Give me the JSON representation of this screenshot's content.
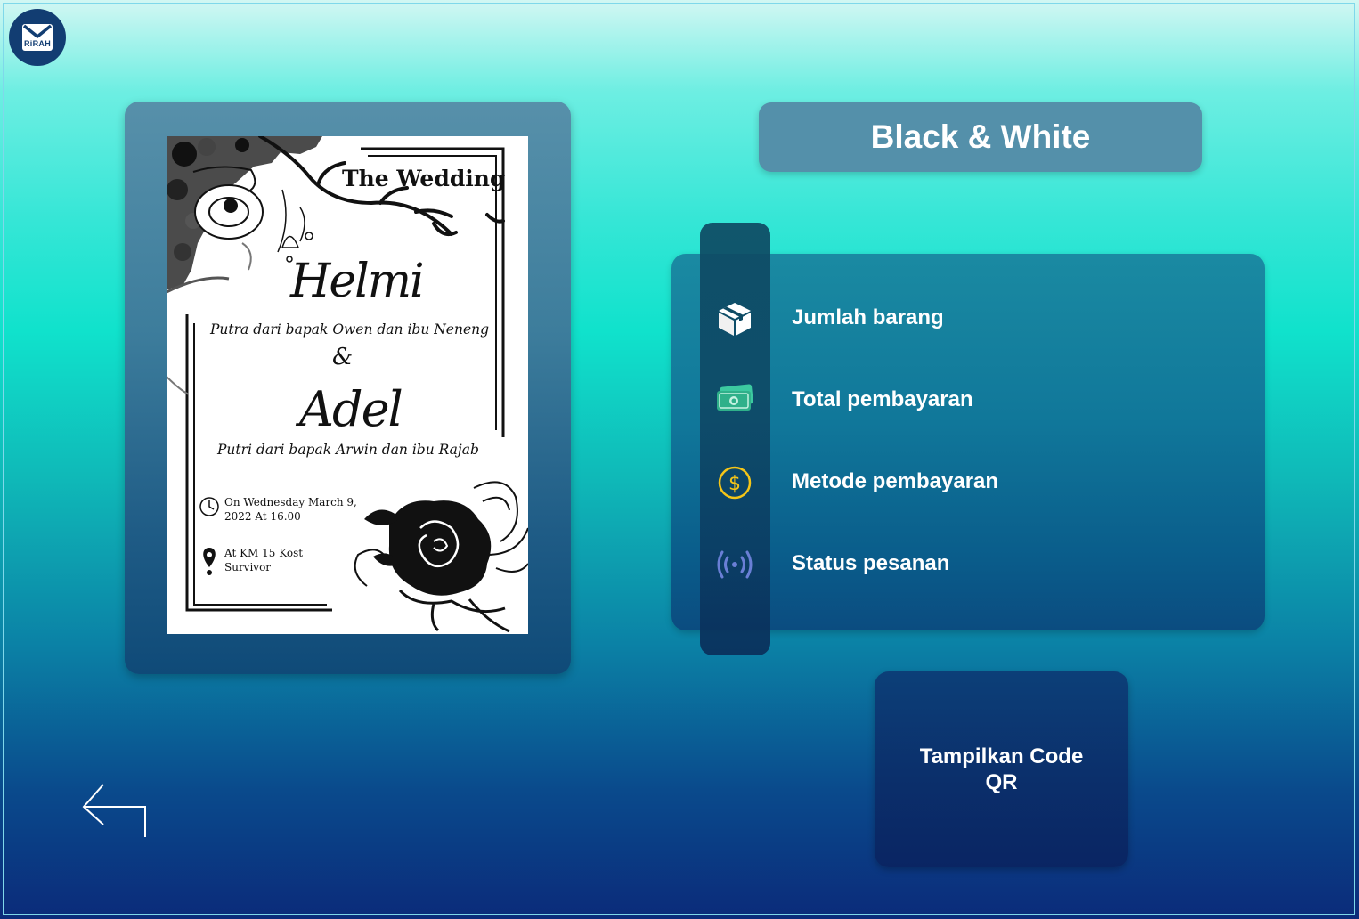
{
  "app": {
    "logo_text": "RiRAH"
  },
  "invitation": {
    "title": "The Wedding",
    "groom_name": "Helmi",
    "groom_parents": "Putra dari bapak Owen dan ibu Neneng",
    "ampersand": "&",
    "bride_name": "Adel",
    "bride_parents": "Putri dari bapak Arwin dan ibu Rajab",
    "date_text": "On Wednesday March 9, 2022 At 16.00",
    "place_text": "At KM 15 Kost Survivor"
  },
  "product": {
    "name": "Black & White"
  },
  "details": [
    {
      "label": "Jumlah barang",
      "icon": "package-icon"
    },
    {
      "label": "Total pembayaran",
      "icon": "money-icon"
    },
    {
      "label": "Metode pembayaran",
      "icon": "dollar-coin-icon"
    },
    {
      "label": "Status pesanan",
      "icon": "broadcast-icon"
    }
  ],
  "actions": {
    "qr_button_label": "Tampilkan Code QR"
  },
  "navigation": {
    "back_icon": "back-arrow-icon"
  },
  "colors": {
    "title_box": "#5490aa",
    "qr_button": "#0b2f6b",
    "money_icon": "#3cc9a0",
    "coin_icon": "#f5c518",
    "broadcast_icon": "#6a7fd6"
  }
}
